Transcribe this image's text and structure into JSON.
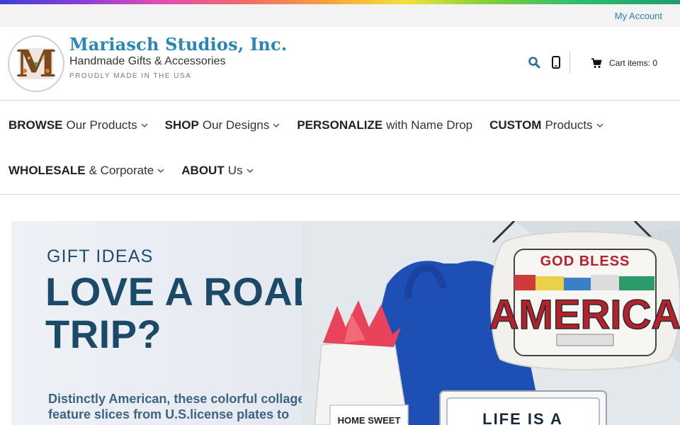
{
  "topbar": {
    "my_account": "My Account"
  },
  "brand": {
    "name": "Mariasch Studios, Inc.",
    "subtitle": "Handmade Gifts & Accessories",
    "tagline": "PROUDLY MADE IN THE USA",
    "logo_letter": "M"
  },
  "header": {
    "cart_label": "Cart items: 0",
    "icons": [
      "search-icon",
      "phone-icon",
      "cart-icon"
    ]
  },
  "nav": {
    "items": [
      {
        "bold": "BROWSE",
        "rest": "Our Products",
        "dropdown": true
      },
      {
        "bold": "SHOP",
        "rest": "Our Designs",
        "dropdown": true
      },
      {
        "bold": "PERSONALIZE",
        "rest": "with Name Drop",
        "dropdown": false
      },
      {
        "bold": "CUSTOM",
        "rest": "Products",
        "dropdown": true
      },
      {
        "bold": "WHOLESALE",
        "rest": "& Corporate",
        "dropdown": true
      },
      {
        "bold": "ABOUT",
        "rest": "Us",
        "dropdown": true
      }
    ]
  },
  "hero": {
    "kicker": "GIFT IDEAS",
    "title": "LOVE A ROAD TRIP?",
    "description": "Distinctly American, these colorful collages feature slices from U.S.license plates to",
    "pillow_top": "GOD BLESS",
    "pillow_main": "AMERICA",
    "bag_text": "LIFE IS A",
    "small_bag_text": "HOME SWEET"
  },
  "colors": {
    "accent": "#2a86b6",
    "hero_title": "#1b4a68",
    "link": "#2c7fb8"
  }
}
